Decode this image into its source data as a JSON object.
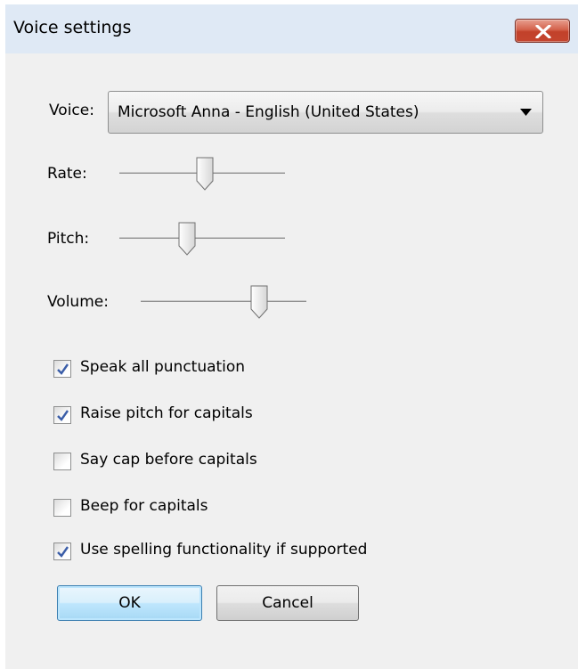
{
  "window": {
    "title": "Voice settings"
  },
  "voice": {
    "label": "Voice:",
    "selected": "Microsoft Anna - English (United States)"
  },
  "sliders": {
    "rate": {
      "label": "Rate:",
      "level": 0.52
    },
    "pitch": {
      "label": "Pitch:",
      "level": 0.4
    },
    "volume": {
      "label": "Volume:",
      "level": 0.74
    }
  },
  "options": [
    {
      "label": "Speak all punctuation",
      "checked": true
    },
    {
      "label": "Raise pitch for capitals",
      "checked": true
    },
    {
      "label": "Say cap before capitals",
      "checked": false
    },
    {
      "label": "Beep for capitals",
      "checked": false
    },
    {
      "label": "Use spelling functionality if supported",
      "checked": true
    }
  ],
  "buttons": {
    "ok": "OK",
    "cancel": "Cancel"
  },
  "colors": {
    "dialog_background": "#f0f0f0",
    "title_bar": "#dfe9f5",
    "close_button": "#c4452e",
    "default_button_border": "#3c7fb1",
    "check_mark": "#3a5da8"
  },
  "icons": {
    "close": "close-x-icon",
    "dropdown": "dropdown-arrow-icon",
    "check": "check-mark-icon"
  }
}
